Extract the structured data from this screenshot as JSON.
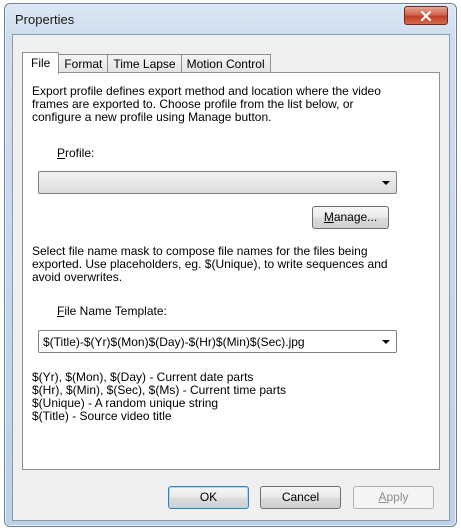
{
  "window": {
    "title": "Properties"
  },
  "tabs": [
    {
      "label": "File",
      "active": true
    },
    {
      "label": "Format",
      "active": false
    },
    {
      "label": "Time Lapse",
      "active": false
    },
    {
      "label": "Motion Control",
      "active": false
    }
  ],
  "file": {
    "export_description": [
      "Export profile defines export method and location where the video",
      "frames are exported to. Choose profile from the list below, or",
      "configure a new profile using Manage button."
    ],
    "profile_label_mnemonic": "P",
    "profile_label_rest": "rofile:",
    "profile_value": "",
    "manage_mnemonic": "M",
    "manage_rest": "anage...",
    "mask_description": [
      "Select file name mask to compose file names for the files being",
      "exported. Use placeholders, eg. $(Unique), to write sequences and",
      "avoid overwrites."
    ],
    "template_label_mnemonic": "F",
    "template_label_rest": "ile Name Template:",
    "template_value": "$(Title)-$(Yr)$(Mon)$(Day)-$(Hr)$(Min)$(Sec).jpg",
    "placeholders": [
      "$(Yr), $(Mon), $(Day) - Current date parts",
      "$(Hr), $(Min), $(Sec), $(Ms) - Current time parts",
      "$(Unique) - A random unique string",
      "$(Title) - Source video title"
    ]
  },
  "buttons": {
    "ok": "OK",
    "cancel": "Cancel",
    "apply_mnemonic": "A",
    "apply_rest": "pply"
  }
}
